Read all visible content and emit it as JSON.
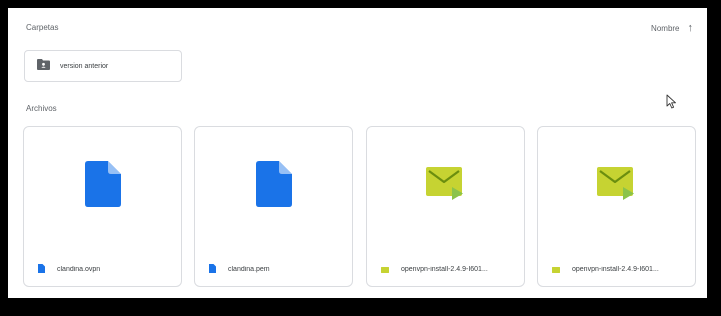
{
  "header": {
    "folders_label": "Carpetas",
    "sort_label": "Nombre",
    "sort_arrow": "↑"
  },
  "folders": [
    {
      "name": "version anterior",
      "icon": "shared-folder-icon"
    }
  ],
  "files_label": "Archivos",
  "files": [
    {
      "name": "clandina.ovpn",
      "icon": "document-icon",
      "color": "#1a73e8"
    },
    {
      "name": "clandina.pem",
      "icon": "document-icon",
      "color": "#1a73e8"
    },
    {
      "name": "openvpn-install-2.4.9-I601...",
      "icon": "email-icon",
      "color": "#c6d332"
    },
    {
      "name": "openvpn-install-2.4.9-I601...",
      "icon": "email-icon",
      "color": "#c6d332"
    }
  ]
}
